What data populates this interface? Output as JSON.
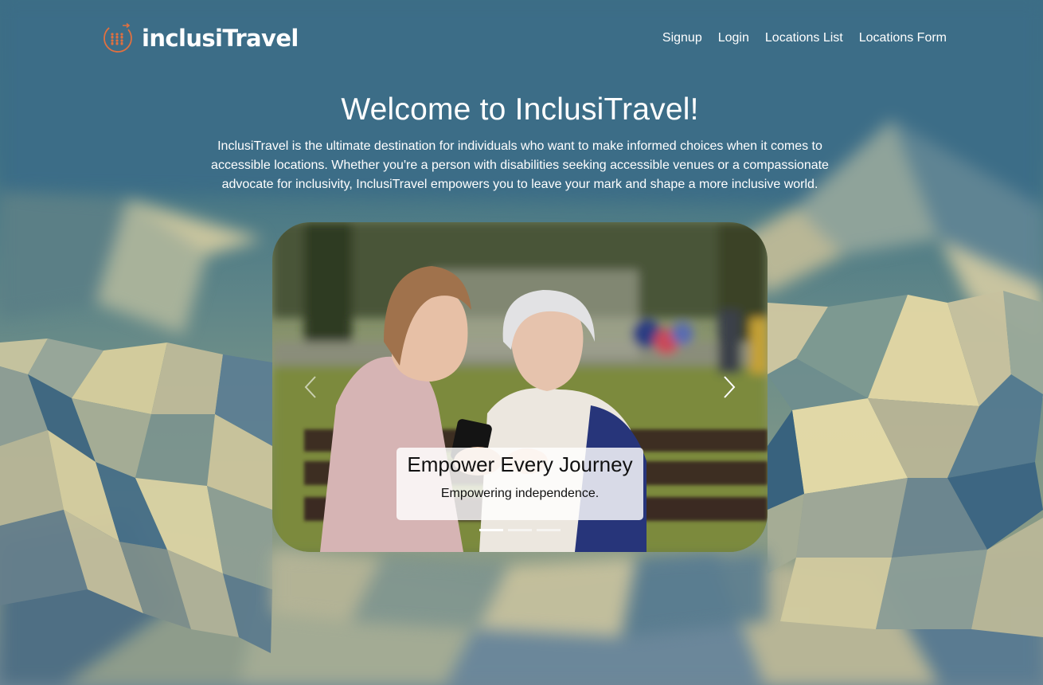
{
  "brand": {
    "name": "inclusiTravel",
    "logo_icon": "people-plane-logo-icon",
    "accent_color": "#e2703f"
  },
  "nav": {
    "links": [
      {
        "label": "Signup"
      },
      {
        "label": "Login"
      },
      {
        "label": "Locations List"
      },
      {
        "label": "Locations Form"
      }
    ]
  },
  "hero": {
    "title": "Welcome to InclusiTravel!",
    "description": "InclusiTravel is the ultimate destination for individuals who want to make informed choices when it comes to accessible locations. Whether you're a person with disabilities seeking accessible venues or a compassionate advocate for inclusivity, InclusiTravel empowers you to leave your mark and shape a more inclusive world."
  },
  "carousel": {
    "caption_title": "Empower Every Journey",
    "caption_text": "Empowering independence.",
    "slide_count": 3,
    "active_index": 0,
    "prev_icon": "chevron-left-icon",
    "next_icon": "chevron-right-icon"
  }
}
